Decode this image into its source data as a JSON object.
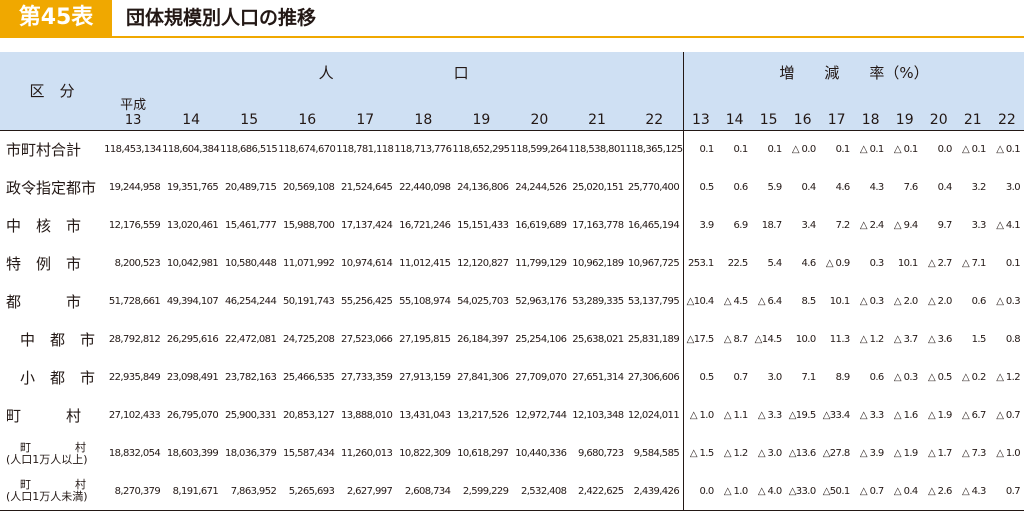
{
  "header": {
    "badge": "第45表",
    "title": "団体規模別人口の推移"
  },
  "table": {
    "group_population": "人　　　　　　　　口",
    "group_rate": "増　　減　　率（%）",
    "row_header": "区　分",
    "pop_years": [
      "平成\n13",
      "14",
      "15",
      "16",
      "17",
      "18",
      "19",
      "20",
      "21",
      "22"
    ],
    "rate_years": [
      "13",
      "14",
      "15",
      "16",
      "17",
      "18",
      "19",
      "20",
      "21",
      "22"
    ],
    "rows": [
      {
        "label": "市町村合計",
        "pop": [
          "118,453,134",
          "118,604,384",
          "118,686,515",
          "118,674,670",
          "118,781,118",
          "118,713,776",
          "118,652,295",
          "118,599,264",
          "118,538,801",
          "118,365,125"
        ],
        "rate": [
          "0.1",
          "0.1",
          "0.1",
          "△ 0.0",
          "0.1",
          "△ 0.1",
          "△ 0.1",
          "0.0",
          "△ 0.1",
          "△ 0.1"
        ]
      },
      {
        "label": "政令指定都市",
        "pop": [
          "19,244,958",
          "19,351,765",
          "20,489,715",
          "20,569,108",
          "21,524,645",
          "22,440,098",
          "24,136,806",
          "24,244,526",
          "25,020,151",
          "25,770,400"
        ],
        "rate": [
          "0.5",
          "0.6",
          "5.9",
          "0.4",
          "4.6",
          "4.3",
          "7.6",
          "0.4",
          "3.2",
          "3.0"
        ]
      },
      {
        "label": "中　核　市",
        "pop": [
          "12,176,559",
          "13,020,461",
          "15,461,777",
          "15,988,700",
          "17,137,424",
          "16,721,246",
          "15,151,433",
          "16,619,689",
          "17,163,778",
          "16,465,194"
        ],
        "rate": [
          "3.9",
          "6.9",
          "18.7",
          "3.4",
          "7.2",
          "△ 2.4",
          "△ 9.4",
          "9.7",
          "3.3",
          "△ 4.1"
        ]
      },
      {
        "label": "特　例　市",
        "pop": [
          "8,200,523",
          "10,042,981",
          "10,580,448",
          "11,071,992",
          "10,974,614",
          "11,012,415",
          "12,120,827",
          "11,799,129",
          "10,962,189",
          "10,967,725"
        ],
        "rate": [
          "253.1",
          "22.5",
          "5.4",
          "4.6",
          "△ 0.9",
          "0.3",
          "10.1",
          "△ 2.7",
          "△ 7.1",
          "0.1"
        ]
      },
      {
        "label": "都　　　市",
        "pop": [
          "51,728,661",
          "49,394,107",
          "46,254,244",
          "50,191,743",
          "55,256,425",
          "55,108,974",
          "54,025,703",
          "52,963,176",
          "53,289,335",
          "53,137,795"
        ],
        "rate": [
          "△10.4",
          "△ 4.5",
          "△ 6.4",
          "8.5",
          "10.1",
          "△ 0.3",
          "△ 2.0",
          "△ 2.0",
          "0.6",
          "△ 0.3"
        ]
      },
      {
        "label": "中　都　市",
        "pop": [
          "28,792,812",
          "26,295,616",
          "22,472,081",
          "24,725,208",
          "27,523,066",
          "27,195,815",
          "26,184,397",
          "25,254,106",
          "25,638,021",
          "25,831,189"
        ],
        "rate": [
          "△17.5",
          "△ 8.7",
          "△14.5",
          "10.0",
          "11.3",
          "△ 1.2",
          "△ 3.7",
          "△ 3.6",
          "1.5",
          "0.8"
        ]
      },
      {
        "label": "小　都　市",
        "pop": [
          "22,935,849",
          "23,098,491",
          "23,782,163",
          "25,466,535",
          "27,733,359",
          "27,913,159",
          "27,841,306",
          "27,709,070",
          "27,651,314",
          "27,306,606"
        ],
        "rate": [
          "0.5",
          "0.7",
          "3.0",
          "7.1",
          "8.9",
          "0.6",
          "△ 0.3",
          "△ 0.5",
          "△ 0.2",
          "△ 1.2"
        ]
      },
      {
        "label": "町　　　村",
        "pop": [
          "27,102,433",
          "26,795,070",
          "25,900,331",
          "20,853,127",
          "13,888,010",
          "13,431,043",
          "13,217,526",
          "12,972,744",
          "12,103,348",
          "12,024,011"
        ],
        "rate": [
          "△ 1.0",
          "△ 1.1",
          "△ 3.3",
          "△19.5",
          "△33.4",
          "△ 3.3",
          "△ 1.6",
          "△ 1.9",
          "△ 6.7",
          "△ 0.7"
        ]
      },
      {
        "label": "町　　　　村",
        "sub": "(人口1万人以上)",
        "pop": [
          "18,832,054",
          "18,603,399",
          "18,036,379",
          "15,587,434",
          "11,260,013",
          "10,822,309",
          "10,618,297",
          "10,440,336",
          "9,680,723",
          "9,584,585"
        ],
        "rate": [
          "△ 1.5",
          "△ 1.2",
          "△ 3.0",
          "△13.6",
          "△27.8",
          "△ 3.9",
          "△ 1.9",
          "△ 1.7",
          "△ 7.3",
          "△ 1.0"
        ]
      },
      {
        "label": "町　　　　村",
        "sub": "(人口1万人未満)",
        "pop": [
          "8,270,379",
          "8,191,671",
          "7,863,952",
          "5,265,693",
          "2,627,997",
          "2,608,734",
          "2,599,229",
          "2,532,408",
          "2,422,625",
          "2,439,426"
        ],
        "rate": [
          "0.0",
          "△ 1.0",
          "△ 4.0",
          "△33.0",
          "△50.1",
          "△ 0.7",
          "△ 0.4",
          "△ 2.6",
          "△ 4.3",
          "0.7"
        ]
      }
    ]
  }
}
